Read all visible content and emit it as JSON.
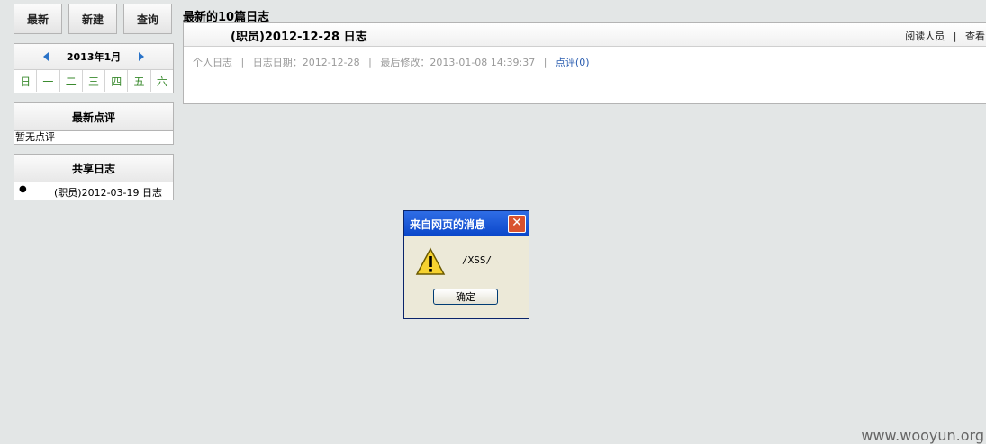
{
  "toolbar": {
    "latest_label": "最新",
    "new_label": "新建",
    "search_label": "查询"
  },
  "calendar": {
    "month": "2013年1月",
    "weekdays": [
      "日",
      "一",
      "二",
      "三",
      "四",
      "五",
      "六"
    ]
  },
  "latest_comments": {
    "title": "最新点评",
    "empty_text": "暂无点评"
  },
  "shared": {
    "title": "共享日志",
    "items": [
      {
        "text": "(职员)2012-03-19 日志"
      }
    ]
  },
  "main": {
    "section_title": "最新的10篇日志",
    "entry": {
      "title": "(职员)2012-12-28 日志",
      "readers_label": "阅读人员",
      "view_label": "查看",
      "type": "个人日志",
      "date": "日志日期：2012-12-28",
      "modified": "最后修改：2013-01-08 14:39:37",
      "comments_link": "点评(0)"
    }
  },
  "dialog": {
    "title": "来自网页的消息",
    "message": "/XSS/",
    "ok_label": "确定",
    "icon": "warning-icon"
  },
  "watermark": "www.wooyun.org"
}
